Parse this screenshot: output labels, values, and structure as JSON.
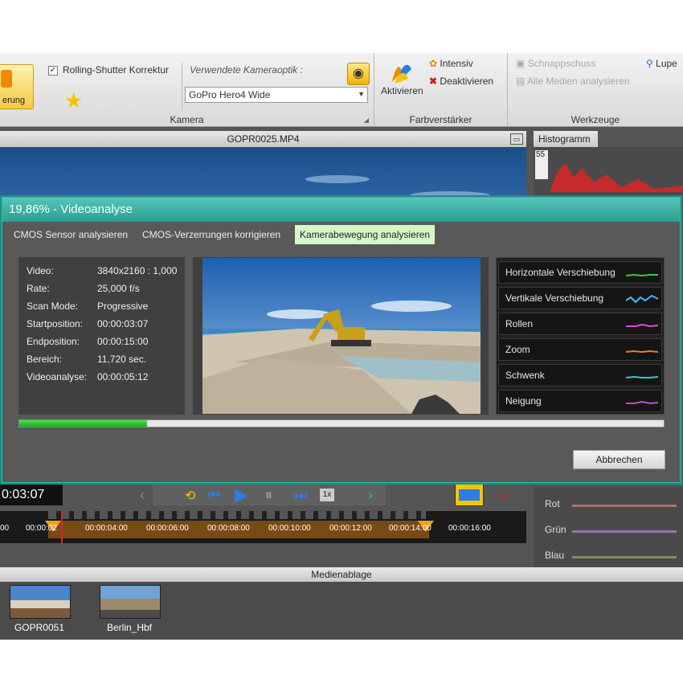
{
  "ribbon": {
    "left_button_label": "erung",
    "rolling_shutter_label": "Rolling-Shutter Korrektur",
    "rolling_shutter_checked": "✓",
    "optik_label": "Verwendete Kameraoptik :",
    "optik_selected": "GoPro Hero4 Wide",
    "camera_group_title": "Kamera",
    "activate_label": "Aktivieren",
    "intensiv_label": "Intensiv",
    "deactivate_label": "Deaktivieren",
    "color_group_title": "Farbverstärker",
    "snapshot_label": "Schnappschuss",
    "analyze_all_label": "Alle Medien analysieren",
    "magnifier_label": "Lupe",
    "tools_group_title": "Werkzeuge"
  },
  "document": {
    "tab_title": "GOPR0025.MP4"
  },
  "histogram": {
    "tab_label": "Histogramm",
    "value": "55"
  },
  "dialog": {
    "title": "19,86% - Videoanalyse",
    "progress_percent": 19.86,
    "tabs": [
      {
        "label": "CMOS Sensor analysieren"
      },
      {
        "label": "CMOS-Verzerrungen korrigieren"
      },
      {
        "label": "Kamerabewegung analysieren"
      }
    ],
    "info": [
      {
        "label": "Video:",
        "value": "3840x2160 : 1,000"
      },
      {
        "label": "Rate:",
        "value": "25,000 f/s"
      },
      {
        "label": "Scan Mode:",
        "value": "Progressive"
      },
      {
        "label": "Startposition:",
        "value": "00:00:03:07"
      },
      {
        "label": "Endposition:",
        "value": "00:00:15:00"
      },
      {
        "label": "Bereich:",
        "value": "11,720 sec."
      },
      {
        "label": "Videoanalyse:",
        "value": "00:00:05:12"
      }
    ],
    "analysis": [
      {
        "label": "Horizontale Verschiebung",
        "color": "#3ccc3c"
      },
      {
        "label": "Vertikale Verschiebung",
        "color": "#4fb6ff"
      },
      {
        "label": "Rollen",
        "color": "#d84fd8"
      },
      {
        "label": "Zoom",
        "color": "#f07a30"
      },
      {
        "label": "Schwenk",
        "color": "#3cc8c8"
      },
      {
        "label": "Neigung",
        "color": "#b84fe0"
      }
    ],
    "cancel_label": "Abbrechen"
  },
  "playback": {
    "timecode": "0:03:07",
    "speed_label": "1x",
    "timeline_ticks": [
      "00",
      "00:00:02",
      "00:00:04:00",
      "00:00:06:00",
      "00:00:08:00",
      "00:00:10:00",
      "00:00:12:00",
      "00:00:14:00",
      "00:00:16:00"
    ]
  },
  "color_panel": {
    "red_label": "Rot",
    "green_label": "Grün",
    "blue_label": "Blau"
  },
  "media": {
    "bar_title": "Medienablage",
    "items": [
      {
        "name": "GOPR0051"
      },
      {
        "name": "Berlin_Hbf"
      }
    ]
  }
}
